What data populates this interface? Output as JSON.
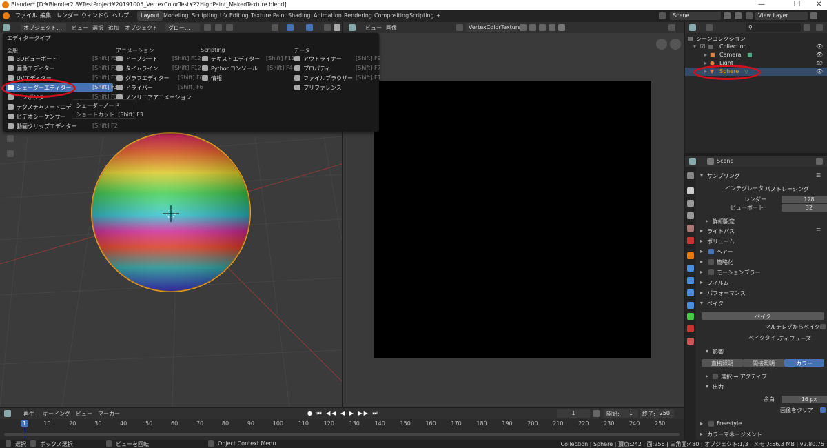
{
  "window": {
    "title": "Blender* [D:¥Blender2.8¥TestProject¥20191005_VertexColorTest¥22HighPaint_MakedTexture.blend]",
    "min": "—",
    "max": "❐",
    "close": "✕"
  },
  "menu": [
    "ファイル",
    "編集",
    "レンダー",
    "ウィンドウ",
    "ヘルプ"
  ],
  "workspaces": [
    {
      "label": "Layout",
      "active": true
    },
    {
      "label": "Modeling"
    },
    {
      "label": "Sculpting"
    },
    {
      "label": "UV Editing"
    },
    {
      "label": "Texture Paint"
    },
    {
      "label": "Shading"
    },
    {
      "label": "Animation"
    },
    {
      "label": "Rendering"
    },
    {
      "label": "Compositing"
    },
    {
      "label": "Scripting"
    },
    {
      "label": "+"
    }
  ],
  "topright": {
    "scene": "Scene",
    "viewlayer": "View Layer"
  },
  "viewport_header": {
    "mode": "オブジェクト...",
    "view": "ビュー",
    "select": "選択",
    "add": "追加",
    "object": "オブジェクト",
    "transform": "グロー..."
  },
  "image_header": {
    "view": "ビュー",
    "image": "画像",
    "image_name": "VertexColorTexture"
  },
  "popup": {
    "title": "エディタータイプ",
    "cols": [
      {
        "header": "全般",
        "items": [
          {
            "label": "3Dビューポート",
            "shortcut": "[Shift] F5"
          },
          {
            "label": "画像エディター",
            "shortcut": "[Shift] F10"
          },
          {
            "label": "UVエディター",
            "shortcut": "[Shift] F10"
          },
          {
            "label": "シェーダーエディター",
            "shortcut": "[Shift] F3",
            "highlight": true
          },
          {
            "label": "コンポジター",
            "shortcut": "[Shift] F3"
          },
          {
            "label": "テクスチャノードエディター",
            "shortcut": ""
          },
          {
            "label": "ビデオシーケンサー",
            "shortcut": ""
          },
          {
            "label": "動画クリップエディター",
            "shortcut": "[Shift] F2"
          }
        ]
      },
      {
        "header": "アニメーション",
        "items": [
          {
            "label": "ドープシート",
            "shortcut": "[Shift] F12"
          },
          {
            "label": "タイムライン",
            "shortcut": "[Shift] F12"
          },
          {
            "label": "グラフエディター",
            "shortcut": "[Shift] F6"
          },
          {
            "label": "ドライバー",
            "shortcut": "[Shift] F6"
          },
          {
            "label": "ノンリニアアニメーション",
            "shortcut": ""
          }
        ]
      },
      {
        "header": "Scripting",
        "items": [
          {
            "label": "テキストエディター",
            "shortcut": "[Shift] F11"
          },
          {
            "label": "Pythonコンソール",
            "shortcut": "[Shift] F4"
          },
          {
            "label": "情報",
            "shortcut": ""
          }
        ]
      },
      {
        "header": "データ",
        "items": [
          {
            "label": "アウトライナー",
            "shortcut": "[Shift] F9"
          },
          {
            "label": "プロパティ",
            "shortcut": "[Shift] F7"
          },
          {
            "label": "ファイルブラウザー",
            "shortcut": "[Shift] F1"
          },
          {
            "label": "プリファレンス",
            "shortcut": ""
          }
        ]
      }
    ]
  },
  "tooltip": {
    "line1": "シェーダーノード",
    "line2": "ショートカット: [Shift] F3"
  },
  "outliner": {
    "root": "シーンコレクション",
    "collection": "Collection",
    "camera": "Camera",
    "light": "Light",
    "sphere": "Sphere"
  },
  "props": {
    "scene": "Scene",
    "sampling": "サンプリング",
    "integrator_label": "インテグレータ",
    "integrator": "パストレーシング",
    "render_label": "レンダー",
    "render": "128",
    "viewport_label": "ビューポート",
    "viewport": "32",
    "advanced": "詳細設定",
    "lightpaths": "ライトパス",
    "volumes": "ボリューム",
    "hair": "ヘアー",
    "simplify": "簡略化",
    "motionblur": "モーションブラー",
    "film": "フィルム",
    "performance": "パフォーマンス",
    "bake": "ベイク",
    "bake_button": "ベイク",
    "multires": "マルチレゾからベイク",
    "baketype_label": "ベイクタイプ",
    "baketype": "ディフューズ",
    "influence": "影響",
    "direct": "直接照明",
    "indirect": "間接照明",
    "color": "カラー",
    "sel_to_active": "選択 → アクティブ",
    "output": "出力",
    "margin_label": "余白",
    "margin": "16 px",
    "clear": "画像をクリア",
    "freestyle": "Freestyle",
    "colormgmt": "カラーマネージメント"
  },
  "timeline": {
    "playback": "再生",
    "keying": "キーイング",
    "view": "ビュー",
    "marker": "マーカー",
    "current": "1",
    "start_label": "開始:",
    "start": "1",
    "end_label": "終了:",
    "end": "250",
    "ticks": [
      "1",
      "10",
      "20",
      "30",
      "40",
      "50",
      "60",
      "70",
      "80",
      "90",
      "100",
      "110",
      "120",
      "130",
      "140",
      "150",
      "160",
      "170",
      "180",
      "190",
      "200",
      "210",
      "220",
      "230",
      "240",
      "250"
    ]
  },
  "status": {
    "select": "選択",
    "box": "ボックス選択",
    "rotate": "ビューを回転",
    "context": "Object Context Menu",
    "info": "Collection | Sphere | 頂点:242 | 面:256 | 三角面:480 | オブジェクト:1/3 | メモリ:56.3 MB | v2.80.75"
  },
  "colors": {
    "accent": "#4772b3",
    "orange": "#e87d0d",
    "annotation": "#d0101a"
  }
}
